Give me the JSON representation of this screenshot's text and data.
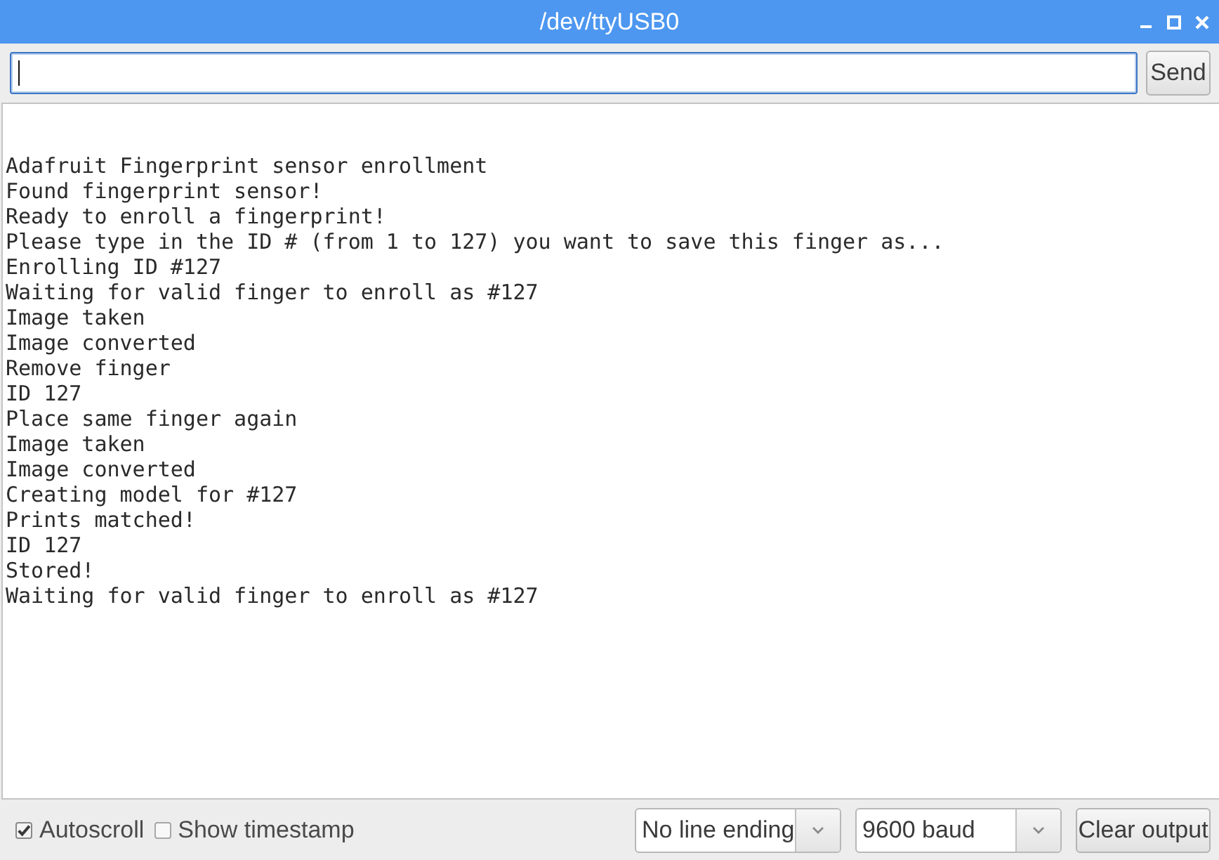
{
  "window": {
    "title": "/dev/ttyUSB0"
  },
  "send_bar": {
    "input": {
      "focused": true
    },
    "send_button": "Send"
  },
  "output": {
    "lines": [
      "Adafruit Fingerprint sensor enrollment",
      "Found fingerprint sensor!",
      "Ready to enroll a fingerprint!",
      "Please type in the ID # (from 1 to 127) you want to save this finger as...",
      "Enrolling ID #127",
      "Waiting for valid finger to enroll as #127",
      "Image taken",
      "Image converted",
      "Remove finger",
      "ID 127",
      "Place same finger again",
      "Image taken",
      "Image converted",
      "Creating model for #127",
      "Prints matched!",
      "ID 127",
      "Stored!",
      "Waiting for valid finger to enroll as #127"
    ]
  },
  "footer": {
    "checkboxes": [
      {
        "label": "Autoscroll",
        "checked": true
      },
      {
        "label": "Show timestamp",
        "checked": false
      }
    ],
    "dropdowns": [
      {
        "value": "No line ending"
      },
      {
        "value": "9600 baud"
      }
    ],
    "clear_button": "Clear output"
  }
}
